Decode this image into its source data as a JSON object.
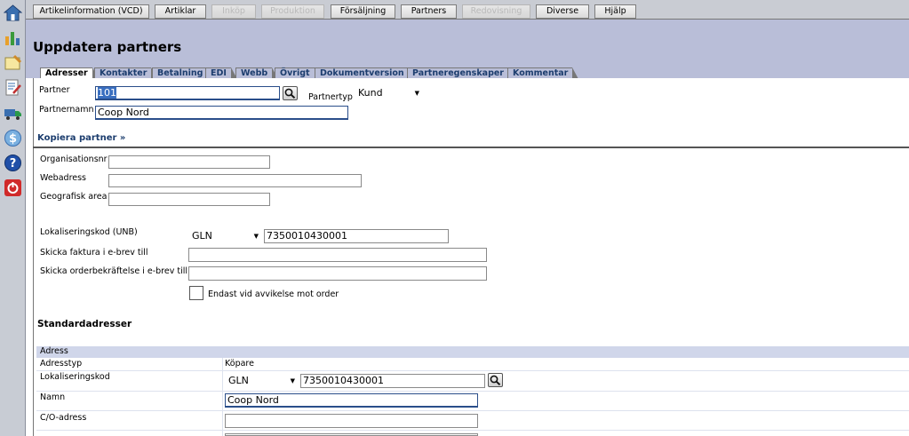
{
  "top_tabs": [
    {
      "label": "Artikelinformation (VCD)",
      "disabled": false
    },
    {
      "label": "Artiklar",
      "disabled": false
    },
    {
      "label": "Inköp",
      "disabled": true
    },
    {
      "label": "Produktion",
      "disabled": true
    },
    {
      "label": "Försäljning",
      "disabled": false
    },
    {
      "label": "Partners",
      "disabled": false
    },
    {
      "label": "Redovisning",
      "disabled": true
    },
    {
      "label": "Diverse",
      "disabled": false
    },
    {
      "label": "Hjälp",
      "disabled": false
    }
  ],
  "page_title": "Uppdatera partners",
  "sub_tabs": [
    "Adresser",
    "Kontakter",
    "Betalning",
    "EDI",
    "Webb",
    "Övrigt",
    "Dokumentversion",
    "Partneregenskaper",
    "Kommentar"
  ],
  "partner": {
    "partner_label": "Partner",
    "partner_value": "101",
    "partnertyp_label": "Partnertyp",
    "partnertyp_value": "Kund",
    "partnernamn_label": "Partnernamn",
    "partnernamn_value": "Coop Nord",
    "copy_link": "Kopiera partner »"
  },
  "details": {
    "org_label": "Organisationsnr",
    "org_value": "",
    "web_label": "Webadress",
    "web_value": "",
    "geo_label": "Geografisk area",
    "geo_value": "",
    "lok_label": "Lokaliseringskod (UNB)",
    "lok_type": "GLN",
    "lok_value": "7350010430001",
    "faktura_label": "Skicka faktura i e-brev till",
    "faktura_value": "",
    "order_label": "Skicka orderbekräftelse i e-brev till",
    "order_value": "",
    "checkbox_label": "Endast vid avvikelse mot order"
  },
  "standard": {
    "heading": "Standardadresser",
    "section": "Adress",
    "adresstyp_label": "Adresstyp",
    "adresstyp_value": "Köpare",
    "lok_label": "Lokaliseringskod",
    "lok_type": "GLN",
    "lok_value": "7350010430001",
    "namn_label": "Namn",
    "namn_value": "Coop Nord",
    "co_label": "C/O-adress",
    "co_value": ""
  },
  "colors": {
    "header_bg": "#b9bed8",
    "link": "#1c3d6e",
    "sidebar": "#c8ccd4"
  }
}
